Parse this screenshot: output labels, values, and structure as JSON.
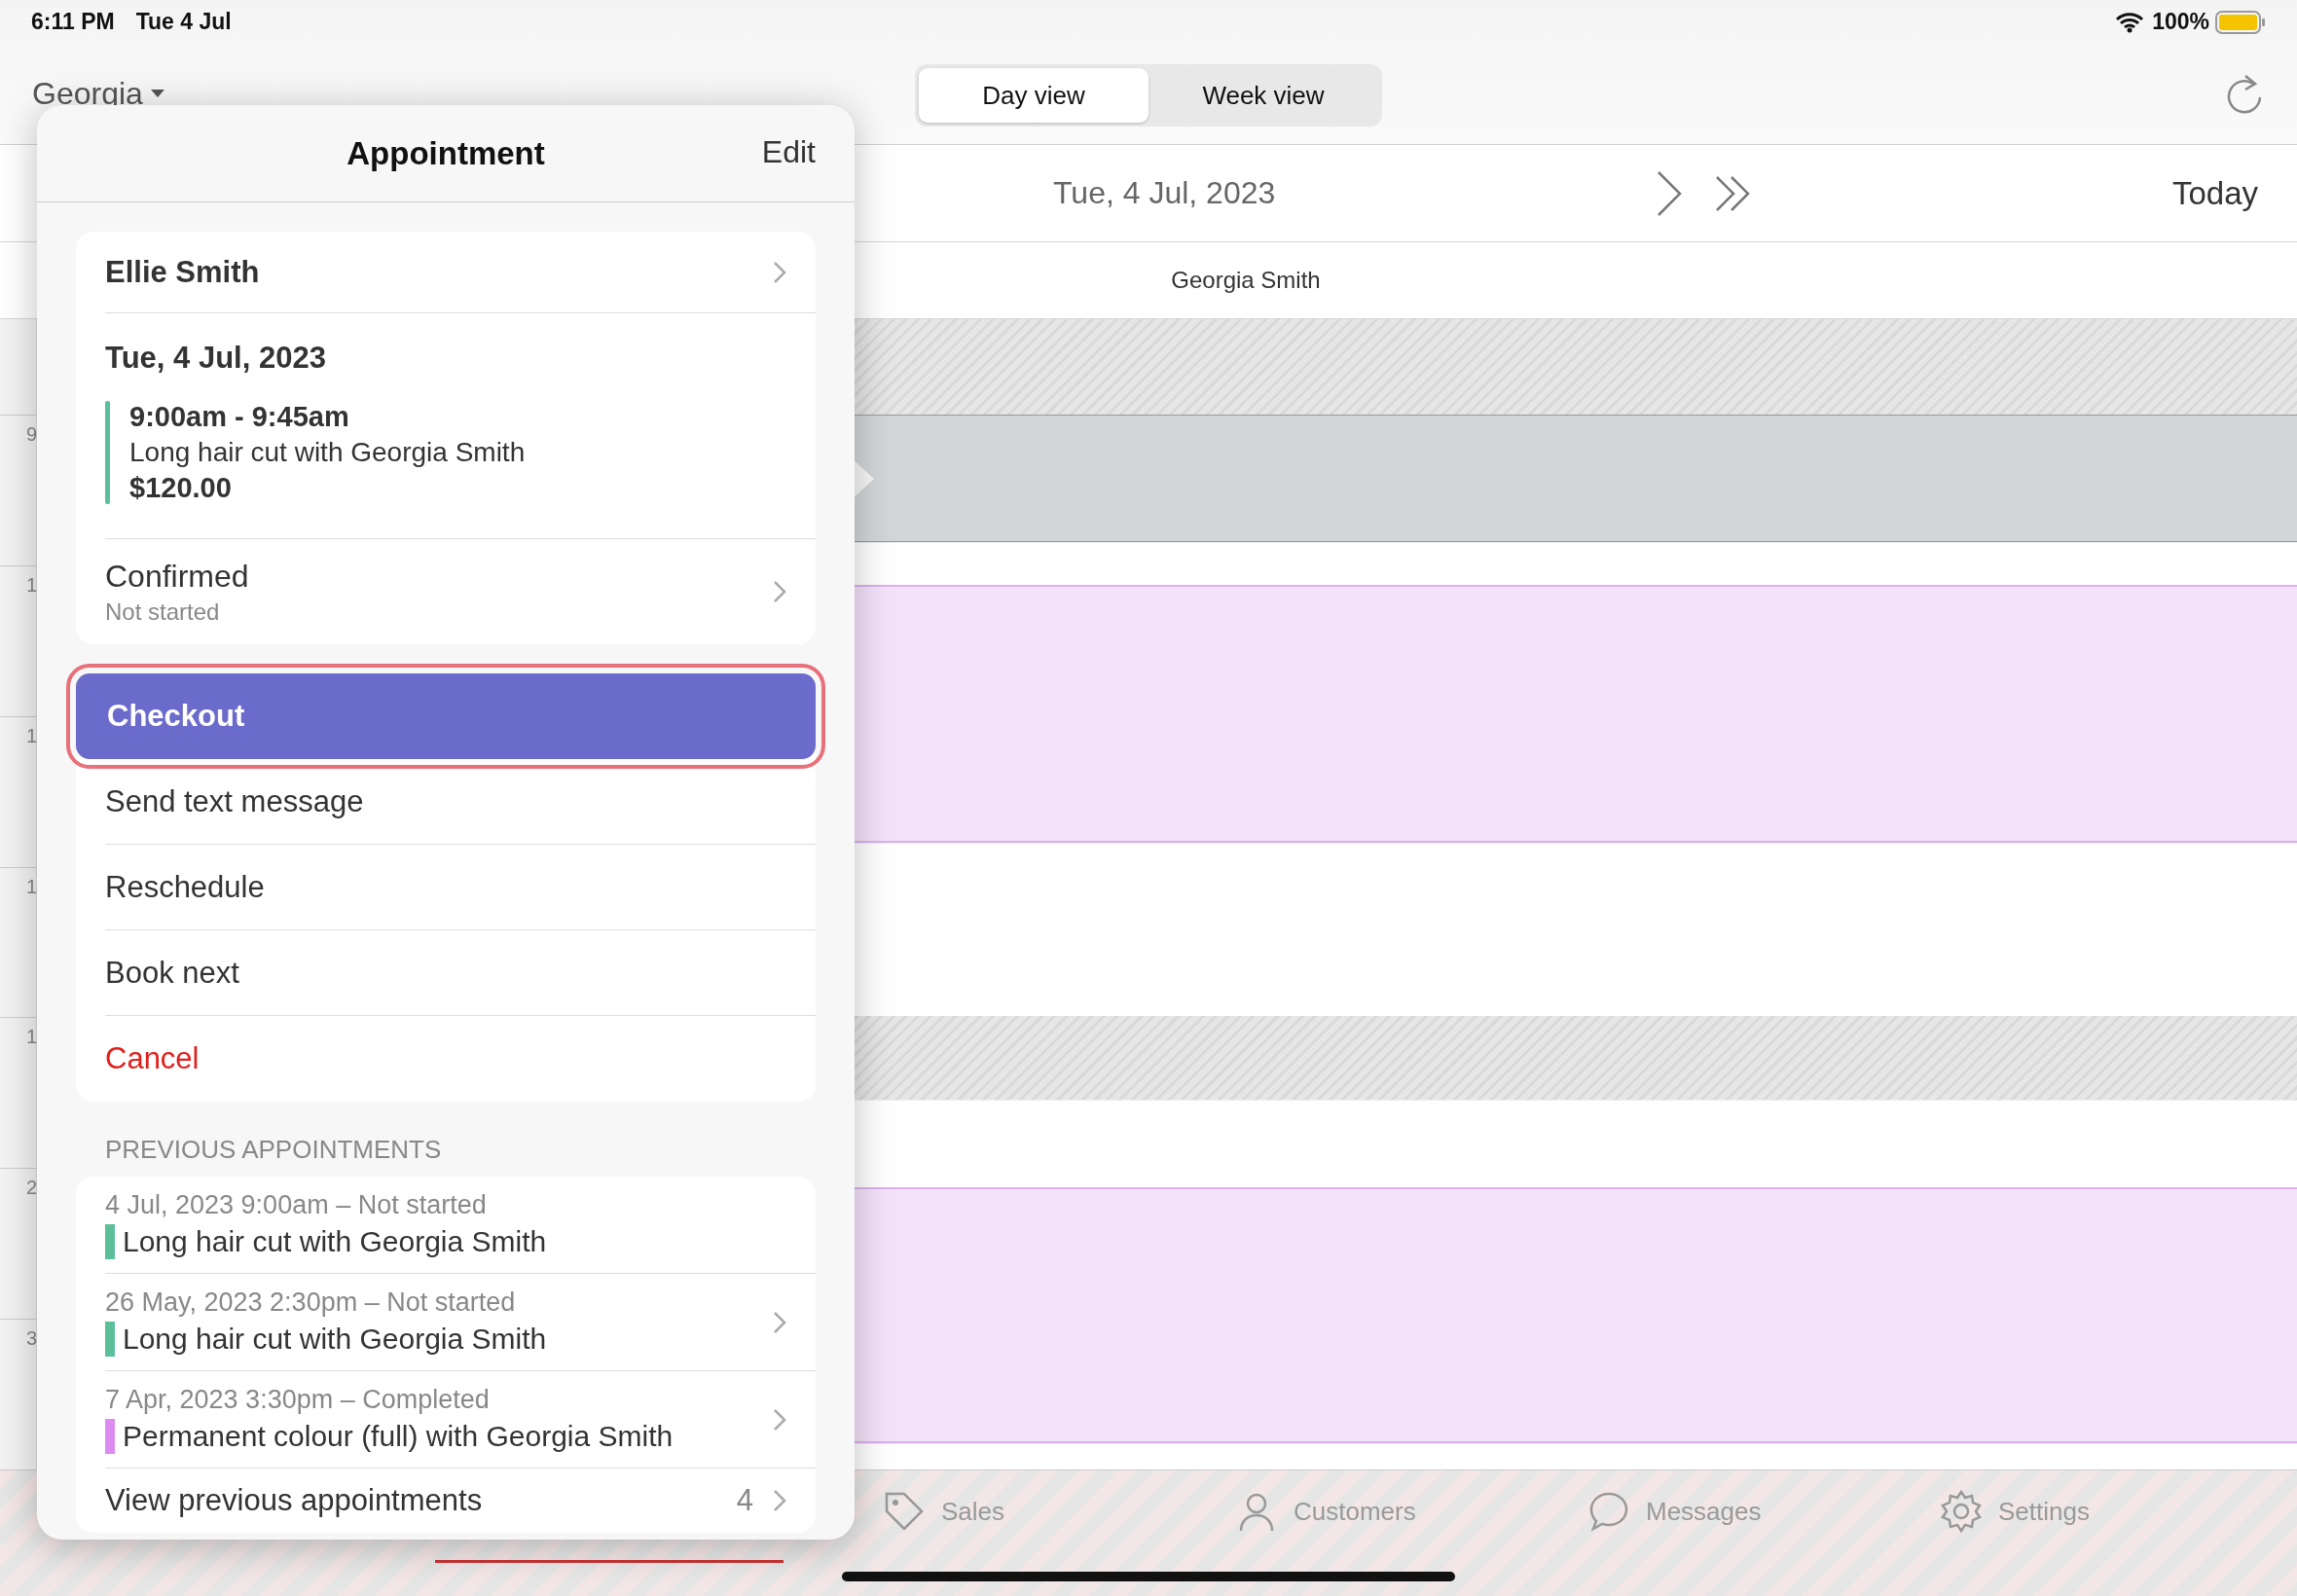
{
  "status_bar": {
    "time": "6:11 PM",
    "date": "Tue 4 Jul",
    "battery": "100%"
  },
  "header": {
    "staff_picker": "Georgia",
    "view_tabs": [
      {
        "label": "Day view",
        "selected": true
      },
      {
        "label": "Week view",
        "selected": false
      }
    ]
  },
  "date_nav": {
    "date": "Tue, 4 Jul, 2023",
    "today": "Today"
  },
  "calendar": {
    "staff_column": "Georgia Smith",
    "hours": [
      "9",
      "1",
      "1",
      "1",
      "1",
      "2",
      "3"
    ],
    "blocks": [
      {
        "kind": "blocked"
      },
      {
        "kind": "busy"
      },
      {
        "kind": "free"
      },
      {
        "kind": "appointment"
      },
      {
        "kind": "free"
      },
      {
        "kind": "blocked"
      },
      {
        "kind": "free"
      },
      {
        "kind": "appointment"
      },
      {
        "kind": "free"
      }
    ]
  },
  "popover": {
    "title": "Appointment",
    "edit": "Edit",
    "client": "Ellie Smith",
    "date": "Tue, 4 Jul, 2023",
    "time": "9:00am - 9:45am",
    "service": "Long hair cut with Georgia Smith",
    "price": "$120.00",
    "status": "Confirmed",
    "progress": "Not started",
    "actions": [
      {
        "label": "Checkout",
        "kind": "primary",
        "highlighted": true
      },
      {
        "label": "Send text message",
        "kind": "normal",
        "highlighted": false
      },
      {
        "label": "Reschedule",
        "kind": "normal",
        "highlighted": false
      },
      {
        "label": "Book next",
        "kind": "normal",
        "highlighted": false
      },
      {
        "label": "Cancel",
        "kind": "destructive",
        "highlighted": false
      }
    ],
    "previous_title": "PREVIOUS APPOINTMENTS",
    "previous": [
      {
        "when": "4 Jul, 2023 9:00am – Not started",
        "service": "Long hair cut with Georgia Smith",
        "color": "#5bbf9c",
        "chevron": false
      },
      {
        "when": "26 May, 2023 2:30pm – Not started",
        "service": "Long hair cut with Georgia Smith",
        "color": "#5bbf9c",
        "chevron": true
      },
      {
        "when": "7 Apr, 2023 3:30pm – Completed",
        "service": "Permanent colour (full) with Georgia Smith",
        "color": "#dc8cf0",
        "chevron": true
      }
    ],
    "view_previous": "View previous appointments",
    "view_previous_count": "4"
  },
  "tab_bar": {
    "items": [
      {
        "label": "Sales"
      },
      {
        "label": "Customers"
      },
      {
        "label": "Messages"
      },
      {
        "label": "Settings"
      }
    ]
  }
}
